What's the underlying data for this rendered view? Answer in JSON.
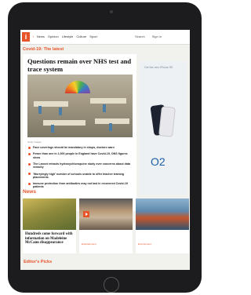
{
  "nav": {
    "logo": "i",
    "links": [
      "i",
      "News",
      "Opinion",
      "Lifestyle",
      "Culture",
      "Sport"
    ],
    "search": "Search",
    "signin": "Sign in"
  },
  "section_covid": "Covid-19: The latest",
  "main_story": {
    "headline": "Questions remain over NHS test and trace system",
    "caption": "Getty Images",
    "bullets": [
      "Face coverings should be mandatory in shops, doctors warn",
      "Fewer than one in 1,000 people in England have Covid-19, ONS figures show",
      "The Lancet retracts hydroxychloroquine study over concerns about data veracity",
      "'Worryingly high' number of schools unable to offer teacher training placements",
      "Immune protection from antibodies may not last in recovered Covid-19 patients"
    ]
  },
  "advert": {
    "text": "Get the new iPhone SE",
    "brand": "O2"
  },
  "section_news": "News",
  "news_cards": [
    {
      "title": "Hundreds come forward with information on Madeleine McCann disappearance",
      "tag": ""
    },
    {
      "title": "",
      "tag": "Entertainment"
    },
    {
      "title": "",
      "tag": "Environment"
    }
  ],
  "section_editors": "Editor's Picks"
}
